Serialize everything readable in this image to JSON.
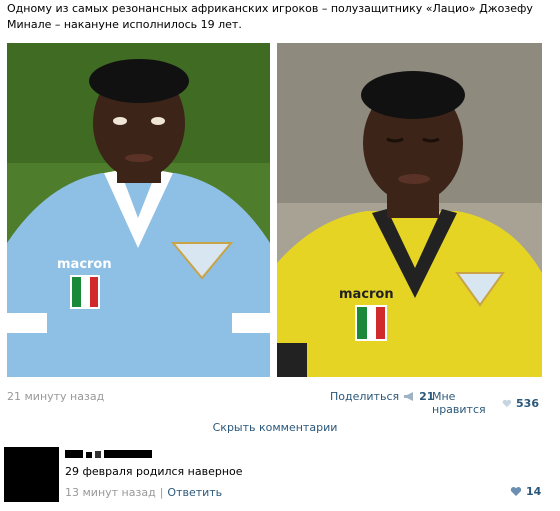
{
  "post": {
    "text": "Одному из самых резонансных африканских игроков – полузащитнику «Лацио» Джозефу Минале – накануне исполнилось 19 лет."
  },
  "photos": [
    {
      "shirt_text": "macron",
      "shirt_color": "#8ebfe4",
      "background": "#4e7d2c"
    },
    {
      "shirt_text": "macron",
      "shirt_color": "#e6d425",
      "background": "#a7a294"
    }
  ],
  "meta": {
    "time": "21 минуту назад",
    "share_label": "Поделиться",
    "share_count": "21",
    "like_label": "Мне нравится",
    "like_count": "536"
  },
  "comments_toggle": "Скрыть комментарии",
  "comment": {
    "text": "29 февраля родился наверное",
    "time": "13 минут назад",
    "separator": "|",
    "reply_label": "Ответить",
    "like_count": "14"
  },
  "colors": {
    "link": "#2b587a",
    "muted": "#999999"
  }
}
